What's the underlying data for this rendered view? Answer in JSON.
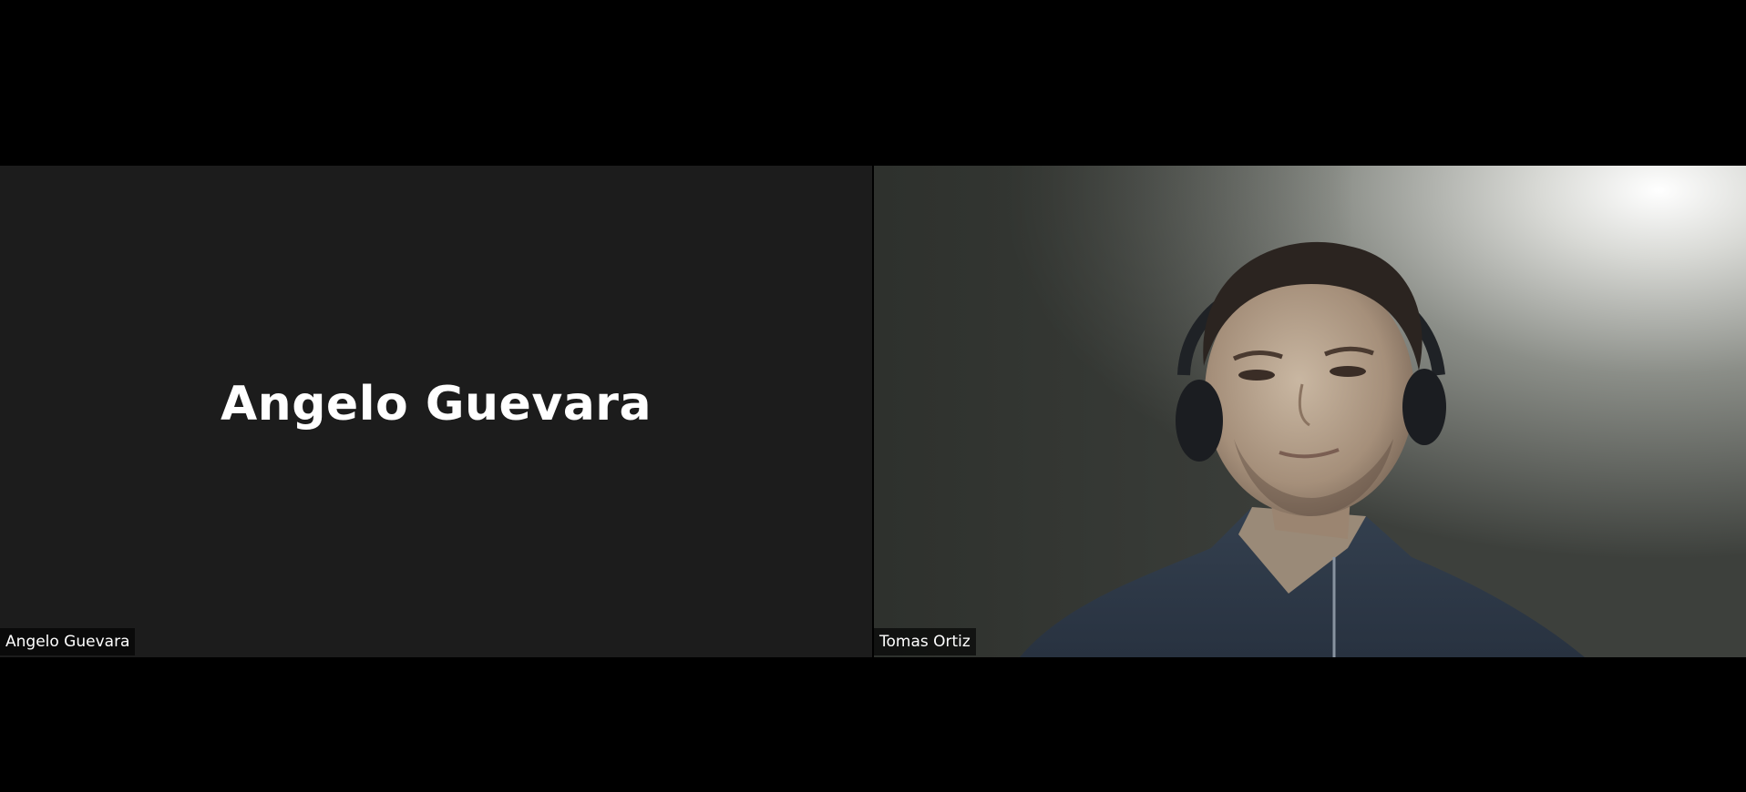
{
  "participants": [
    {
      "name_tag": "Angelo Guevara",
      "display_name": "Angelo Guevara",
      "video": "off"
    },
    {
      "name_tag": "Tomas Ortiz",
      "video": "on"
    }
  ],
  "colors": {
    "background": "#000000",
    "tile_off": "#1c1c1c",
    "label_bg": "#000000",
    "text": "#ffffff"
  }
}
